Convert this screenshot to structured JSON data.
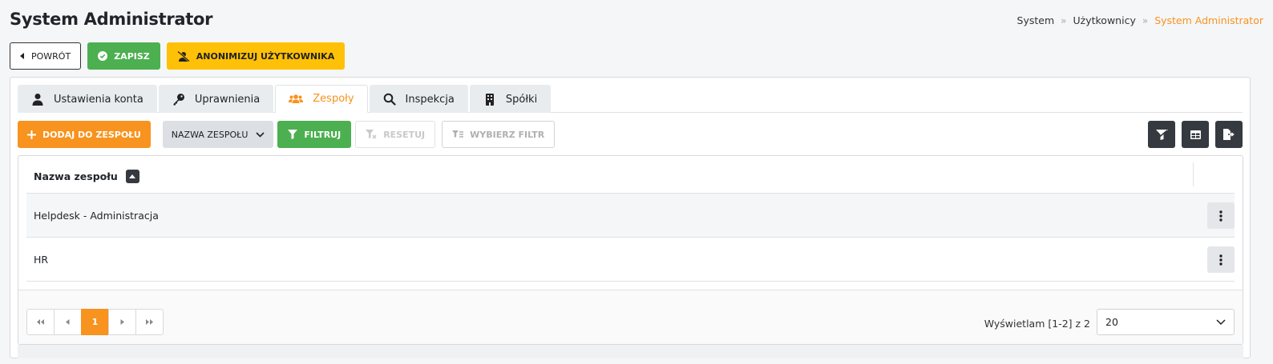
{
  "header": {
    "title": "System Administrator",
    "breadcrumb": [
      {
        "label": "System"
      },
      {
        "label": "Użytkownicy"
      },
      {
        "label": "System Administrator",
        "active": true
      }
    ]
  },
  "actions": {
    "back_label": "POWRÓT",
    "save_label": "ZAPISZ",
    "anonymize_label": "ANONIMIZUJ UŻYTKOWNIKA"
  },
  "tabs": [
    {
      "label": "Ustawienia konta",
      "icon": "user-icon"
    },
    {
      "label": "Uprawnienia",
      "icon": "key-icon"
    },
    {
      "label": "Zespoły",
      "icon": "users-icon",
      "active": true
    },
    {
      "label": "Inspekcja",
      "icon": "search-icon"
    },
    {
      "label": "Spółki",
      "icon": "building-icon"
    }
  ],
  "toolbar": {
    "add_label": "DODAJ DO ZESPOŁU",
    "column_select_value": "NAZWA ZESPOŁU",
    "filter_label": "FILTRUJ",
    "reset_label": "RESETUJ",
    "choose_filter_label": "WYBIERZ FILTR",
    "right_icons": [
      "filter-off-icon",
      "table-columns-icon",
      "export-file-icon"
    ]
  },
  "table": {
    "column_header": "Nazwa zespołu",
    "rows": [
      {
        "name": "Helpdesk - Administracja"
      },
      {
        "name": "HR"
      }
    ]
  },
  "pagination": {
    "current_page": "1",
    "showing_text": "Wyświetlam [1-2] z 2",
    "per_page": "20"
  },
  "colors": {
    "accent": "#f7931e",
    "success": "#4caf50",
    "warning": "#ffc107",
    "dark": "#343a40"
  }
}
